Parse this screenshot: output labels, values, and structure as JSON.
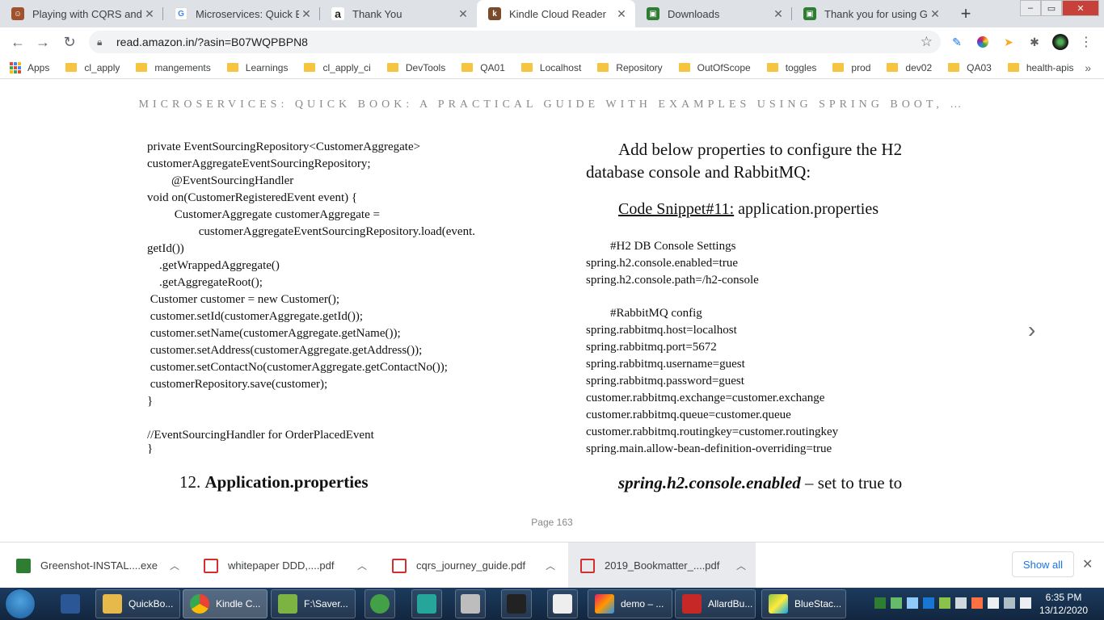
{
  "tabs": [
    {
      "title": "Playing with CQRS and E",
      "favicon_color": "#a0522d",
      "favicon_glyph": "☺"
    },
    {
      "title": "Microservices: Quick Bo",
      "favicon_color": "#4285f4",
      "favicon_glyph": "G"
    },
    {
      "title": "Thank You",
      "favicon_color": "#222222",
      "favicon_glyph": "a"
    },
    {
      "title": "Kindle Cloud Reader",
      "favicon_color": "#7a4b2a",
      "favicon_glyph": "k",
      "active": true
    },
    {
      "title": "Downloads",
      "favicon_color": "#2e7d32",
      "favicon_glyph": "▣"
    },
    {
      "title": "Thank you for using Gre",
      "favicon_color": "#2e7d32",
      "favicon_glyph": "▣"
    }
  ],
  "address": {
    "url": "read.amazon.in/?asin=B07WQPBPN8"
  },
  "bookmarks": [
    "Apps",
    "cl_apply",
    "mangements",
    "Learnings",
    "cl_apply_ci",
    "DevTools",
    "QA01",
    "Localhost",
    "Repository",
    "OutOfScope",
    "toggles",
    "prod",
    "dev02",
    "QA03",
    "health-apis"
  ],
  "book": {
    "title": "MICROSERVICES: QUICK BOOK: A PRACTICAL GUIDE WITH EXAMPLES USING SPRING BOOT, …",
    "left_code": [
      "private EventSourcingRepository<CustomerAggregate>",
      "customerAggregateEventSourcingRepository;",
      "        @EventSourcingHandler",
      "void on(CustomerRegisteredEvent event) {",
      "         CustomerAggregate customerAggregate =",
      "                 customerAggregateEventSourcingRepository.load(event.",
      "getId())",
      "    .getWrappedAggregate()",
      "    .getAggregateRoot();",
      " Customer customer = new Customer();",
      " customer.setId(customerAggregate.getId());",
      " customer.setName(customerAggregate.getName());",
      " customer.setAddress(customerAggregate.getAddress());",
      " customer.setContactNo(customerAggregate.getContactNo());",
      " customerRepository.save(customer);",
      "}",
      "",
      "//EventSourcingHandler for OrderPlacedEvent",
      "}"
    ],
    "section_number": "12.",
    "section_title": "Application.properties",
    "intro_line1": "Add below properties to configure the H2",
    "intro_line2": "database console and RabbitMQ:",
    "snippet_label": "Code Snippet#11:",
    "snippet_name": " application.properties",
    "props_a": [
      "        #H2 DB Console Settings",
      "spring.h2.console.enabled=true",
      "spring.h2.console.path=/h2-console"
    ],
    "props_b": [
      "        #RabbitMQ config",
      "spring.rabbitmq.host=localhost",
      "spring.rabbitmq.port=5672",
      "spring.rabbitmq.username=guest",
      "spring.rabbitmq.password=guest",
      "customer.rabbitmq.exchange=customer.exchange",
      "customer.rabbitmq.queue=customer.queue",
      "customer.rabbitmq.routingkey=customer.routingkey",
      "spring.main.allow-bean-definition-overriding=true"
    ],
    "last_bold": "spring.h2.console.enabled",
    "last_rest": " – set to true to",
    "page_label": "Page 163"
  },
  "downloads": [
    {
      "name": "Greenshot-INSTAL....exe",
      "icon_color": "#2e7d32"
    },
    {
      "name": "whitepaper DDD,....pdf",
      "icon_color": "#d32f2f"
    },
    {
      "name": "cqrs_journey_guide.pdf",
      "icon_color": "#d32f2f"
    },
    {
      "name": "2019_Bookmatter_....pdf",
      "icon_color": "#d32f2f"
    }
  ],
  "shelf": {
    "show_all": "Show all"
  },
  "taskbar": {
    "items": [
      {
        "label": "QuickBo...",
        "color": "#e6b94a"
      },
      {
        "label": "Kindle C...",
        "color": "#4285f4",
        "active": true
      },
      {
        "label": "F:\\Saver...",
        "color": "#7cb342"
      },
      {
        "label": "",
        "color": "#43a047"
      },
      {
        "label": "",
        "color": "#26a69a"
      },
      {
        "label": "",
        "color": "#bdbdbd"
      },
      {
        "label": "",
        "color": "#222222"
      },
      {
        "label": "",
        "color": "#eeeeee"
      },
      {
        "label": "demo – ...",
        "color": "#e91e63"
      },
      {
        "label": "AllardBu...",
        "color": "#c62828"
      },
      {
        "label": "BlueStac...",
        "color": "#8bc34a"
      }
    ],
    "time": "6:35 PM",
    "date": "13/12/2020"
  }
}
